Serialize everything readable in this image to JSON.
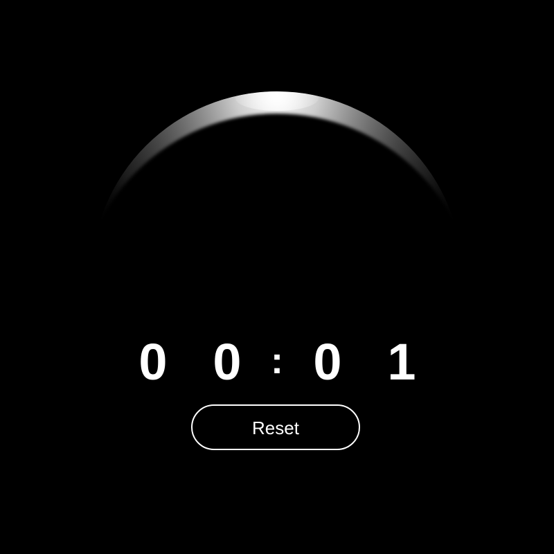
{
  "timer": {
    "digits": [
      "0",
      "0",
      "0",
      "1"
    ],
    "separator": ":"
  },
  "controls": {
    "reset_label": "Reset"
  },
  "colors": {
    "background": "#000000",
    "text": "#ffffff",
    "glow": "#ffffff"
  },
  "icons": {
    "planet": "crescent-planet-icon"
  }
}
